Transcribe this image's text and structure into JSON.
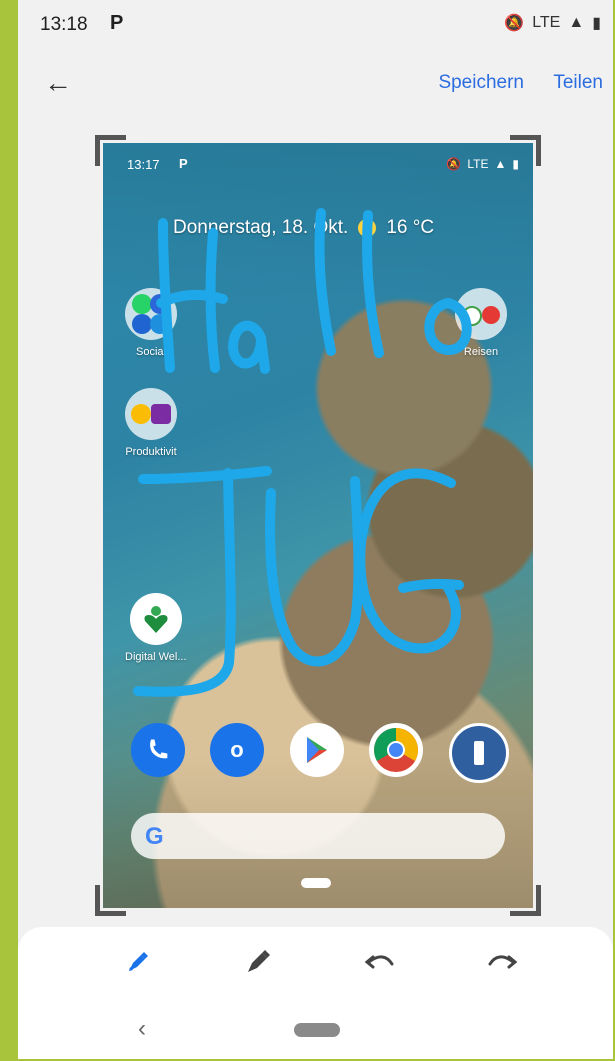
{
  "status_bar": {
    "time": "13:18",
    "p_icon": "P",
    "network": "LTE",
    "icons": [
      "mute-icon",
      "signal-icon",
      "battery-icon"
    ]
  },
  "appbar": {
    "back_icon": "back-arrow-icon",
    "save_label": "Speichern",
    "share_label": "Teilen"
  },
  "screenshot": {
    "status": {
      "time": "13:17",
      "p_icon": "P",
      "network": "LTE"
    },
    "date_text": "Donnerstag, 18. Okt.",
    "temperature": "16 °C",
    "apps": [
      {
        "label": "Social"
      },
      {
        "label": "Reisen"
      },
      {
        "label": "Produktivit"
      },
      {
        "label": "Digital Wel..."
      }
    ],
    "dock_icons": [
      "phone-icon",
      "outlook-icon",
      "play-store-icon",
      "chrome-icon",
      "1password-icon"
    ],
    "search_logo": "G",
    "annotation_text": [
      "Hallo",
      "JUG"
    ]
  },
  "toolbar": {
    "tools": [
      "marker-icon",
      "highlighter-icon",
      "undo-icon",
      "redo-icon"
    ]
  },
  "system_nav": {
    "back_icon": "nav-back-icon",
    "home_icon": "nav-home-pill"
  },
  "colors": {
    "accent": "#2b6de0",
    "frame": "#a8c33c",
    "scribble": "#1ea8ea"
  }
}
